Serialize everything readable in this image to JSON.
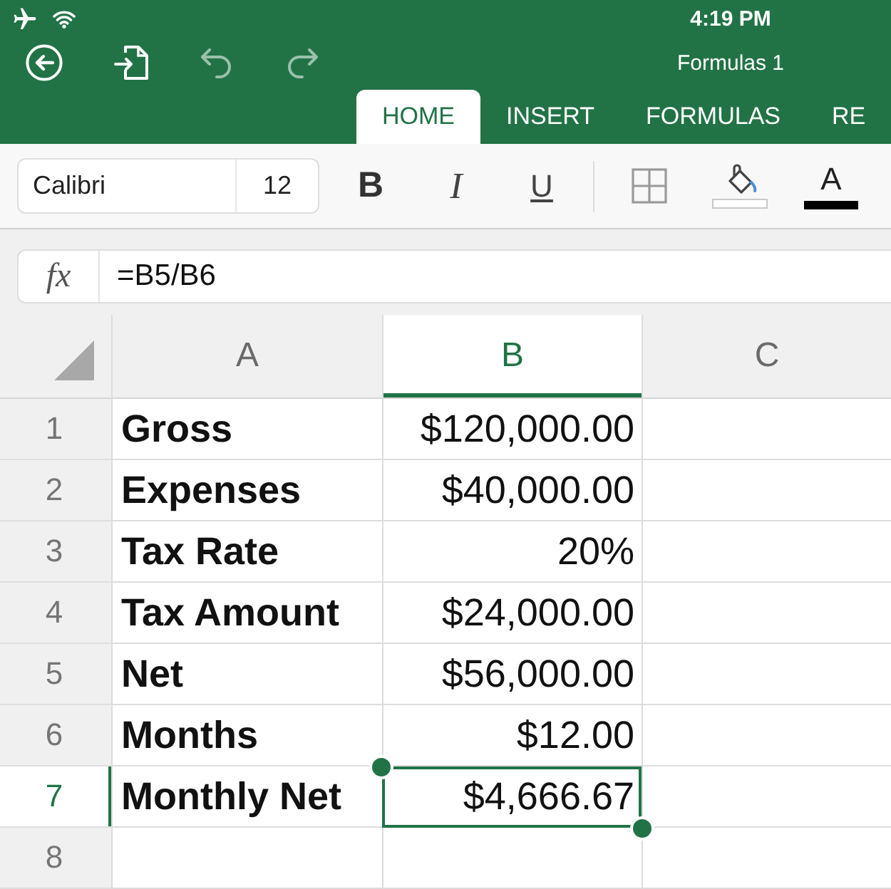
{
  "status_bar": {
    "time": "4:19 PM"
  },
  "toolbar": {
    "buttons": [
      {
        "kind": "back",
        "disabled": false
      },
      {
        "kind": "share",
        "disabled": false
      },
      {
        "kind": "undo",
        "disabled": true
      },
      {
        "kind": "redo",
        "disabled": true
      }
    ],
    "title": "Formulas 1"
  },
  "tabs": [
    {
      "label": "HOME",
      "selected": true
    },
    {
      "label": "INSERT",
      "selected": false
    },
    {
      "label": "FORMULAS",
      "selected": false
    },
    {
      "label": "RE",
      "selected": false
    }
  ],
  "ribbon": {
    "font_name": "Calibri",
    "font_size": "12",
    "text_style_buttons": [
      {
        "kind": "bold",
        "label": "B"
      },
      {
        "kind": "italic",
        "label": "I"
      },
      {
        "kind": "underline",
        "label": "U"
      }
    ],
    "format_buttons": [
      {
        "kind": "borders"
      },
      {
        "kind": "fill_color"
      },
      {
        "kind": "font_color",
        "label": "A"
      }
    ]
  },
  "formula_bar": {
    "function_label": "fx",
    "value": "=B5/B6"
  },
  "sheet": {
    "columns": [
      {
        "label": "A",
        "selected": false
      },
      {
        "label": "B",
        "selected": true
      },
      {
        "label": "C",
        "selected": false
      }
    ],
    "rows": [
      {
        "number": "1",
        "selected": false,
        "cells": [
          {
            "kind": "label",
            "text": "Gross"
          },
          {
            "kind": "number",
            "text": "$120,000.00"
          }
        ]
      },
      {
        "number": "2",
        "selected": false,
        "cells": [
          {
            "kind": "label",
            "text": "Expenses"
          },
          {
            "kind": "number",
            "text": "$40,000.00"
          }
        ]
      },
      {
        "number": "3",
        "selected": false,
        "cells": [
          {
            "kind": "label",
            "text": "Tax Rate"
          },
          {
            "kind": "number",
            "text": "20%"
          }
        ]
      },
      {
        "number": "4",
        "selected": false,
        "cells": [
          {
            "kind": "label",
            "text": "Tax Amount"
          },
          {
            "kind": "number",
            "text": "$24,000.00"
          }
        ]
      },
      {
        "number": "5",
        "selected": false,
        "cells": [
          {
            "kind": "label",
            "text": "Net"
          },
          {
            "kind": "number",
            "text": "$56,000.00"
          }
        ]
      },
      {
        "number": "6",
        "selected": false,
        "cells": [
          {
            "kind": "label",
            "text": "Months"
          },
          {
            "kind": "number",
            "text": "$12.00"
          }
        ]
      },
      {
        "number": "7",
        "selected": true,
        "cells": [
          {
            "kind": "label",
            "text": "Monthly Net"
          },
          {
            "kind": "number",
            "text": "$4,666.67"
          }
        ]
      },
      {
        "number": "8",
        "selected": false
      }
    ]
  }
}
